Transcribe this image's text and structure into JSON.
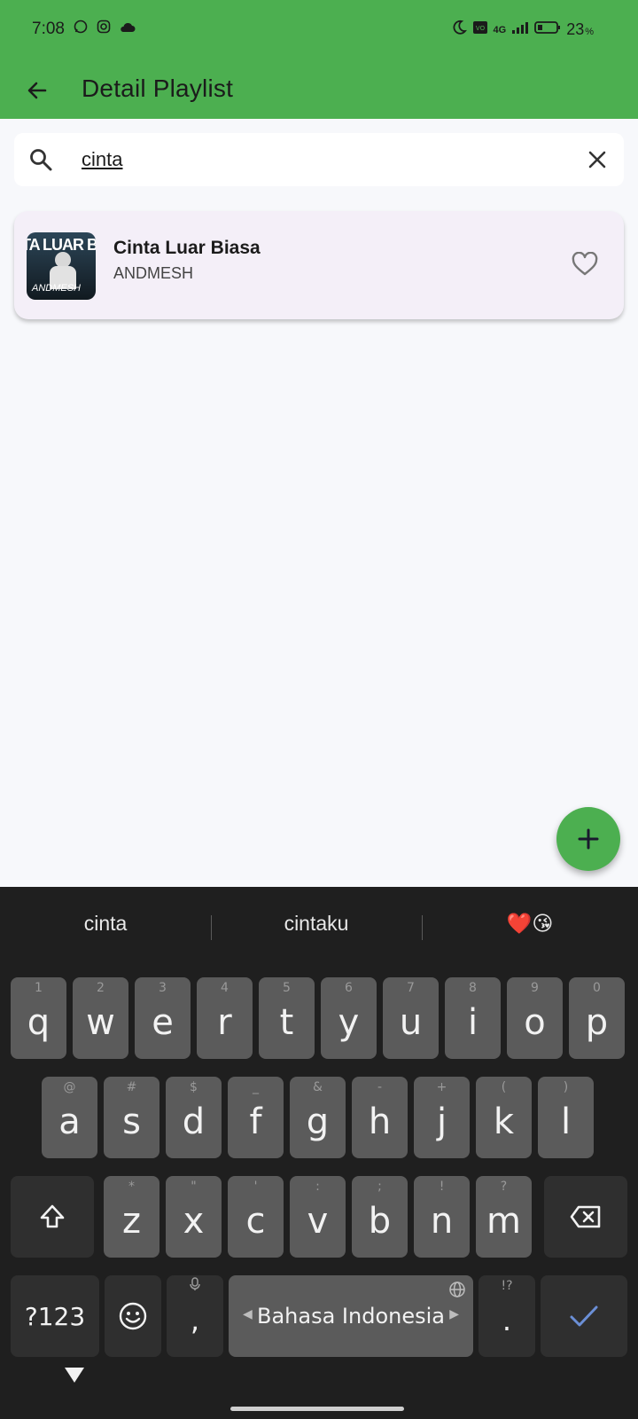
{
  "status": {
    "time": "7:08",
    "battery": "23",
    "battery_unit": "%",
    "network": "4G"
  },
  "header": {
    "title": "Detail Playlist"
  },
  "search": {
    "value": "cinta",
    "placeholder": ""
  },
  "song": {
    "title": "Cinta Luar Biasa",
    "artist": "ANDMESH",
    "cover_title": "TA LUAR BIA",
    "cover_artist": "ANDMESH"
  },
  "keyboard": {
    "suggestions": [
      "cinta",
      "cintaku",
      "❤️😘"
    ],
    "row1": [
      {
        "k": "q",
        "h": "1"
      },
      {
        "k": "w",
        "h": "2"
      },
      {
        "k": "e",
        "h": "3"
      },
      {
        "k": "r",
        "h": "4"
      },
      {
        "k": "t",
        "h": "5"
      },
      {
        "k": "y",
        "h": "6"
      },
      {
        "k": "u",
        "h": "7"
      },
      {
        "k": "i",
        "h": "8"
      },
      {
        "k": "o",
        "h": "9"
      },
      {
        "k": "p",
        "h": "0"
      }
    ],
    "row2": [
      {
        "k": "a",
        "h": "@"
      },
      {
        "k": "s",
        "h": "#"
      },
      {
        "k": "d",
        "h": "$"
      },
      {
        "k": "f",
        "h": "_"
      },
      {
        "k": "g",
        "h": "&"
      },
      {
        "k": "h",
        "h": "-"
      },
      {
        "k": "j",
        "h": "+"
      },
      {
        "k": "k",
        "h": "("
      },
      {
        "k": "l",
        "h": ")"
      }
    ],
    "row3": [
      {
        "k": "z",
        "h": "*"
      },
      {
        "k": "x",
        "h": "\""
      },
      {
        "k": "c",
        "h": "'"
      },
      {
        "k": "v",
        "h": ":"
      },
      {
        "k": "b",
        "h": ";"
      },
      {
        "k": "n",
        "h": "!"
      },
      {
        "k": "m",
        "h": "?"
      }
    ],
    "symbols_label": "?123",
    "comma": ",",
    "space_label": "Bahasa Indonesia",
    "period": ".",
    "period_hint": "!?"
  }
}
